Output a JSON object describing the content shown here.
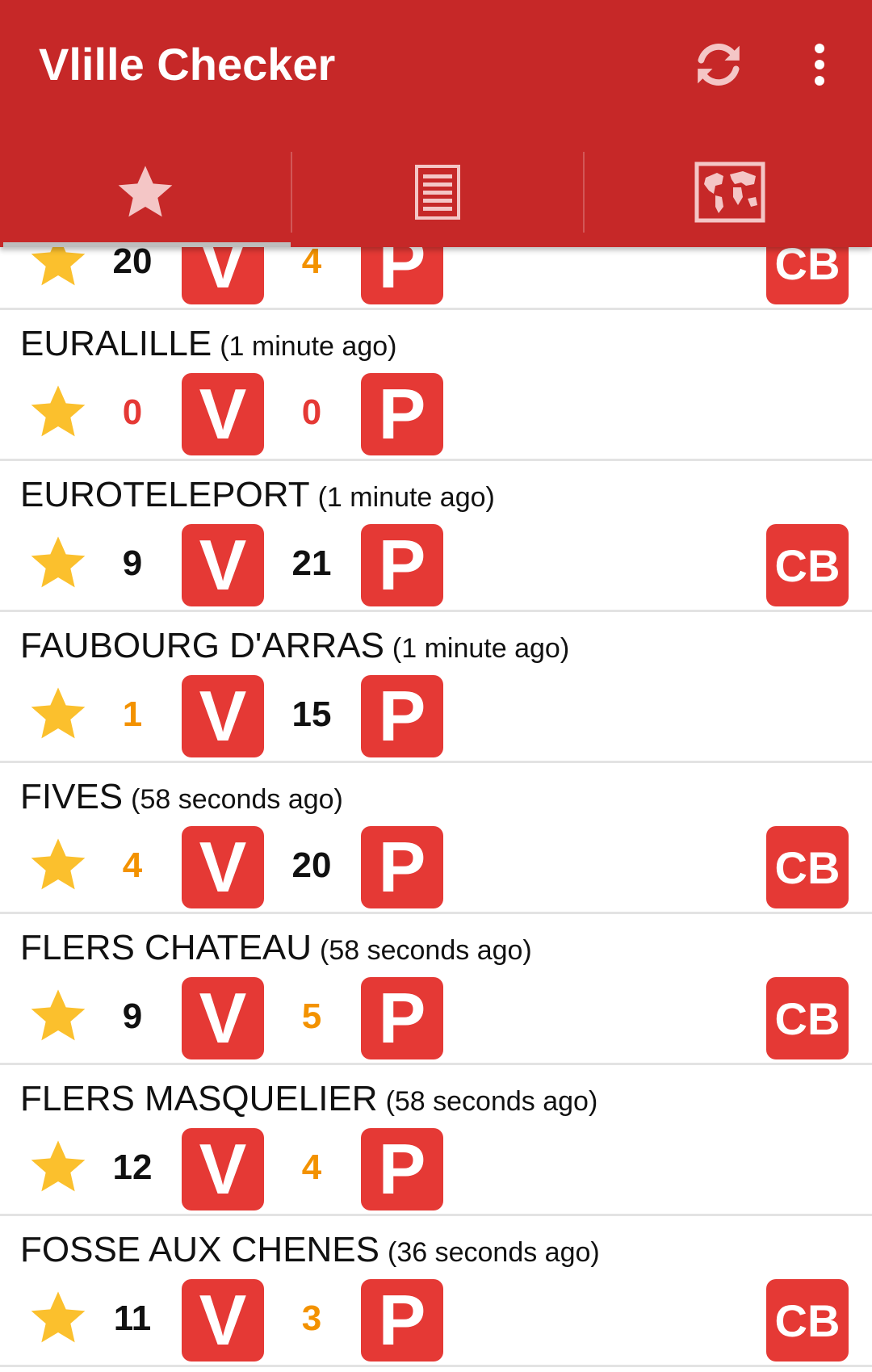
{
  "app": {
    "title": "Vlille Checker"
  },
  "actions": {
    "refresh_icon": "refresh-icon",
    "menu_icon": "more-vert-icon"
  },
  "tabs": [
    {
      "icon": "star-icon",
      "selected": true
    },
    {
      "icon": "list-icon",
      "selected": false
    },
    {
      "icon": "map-icon",
      "selected": false
    }
  ],
  "colors": {
    "primary": "#c62828",
    "badge": "#e53935",
    "star": "#fbc02d",
    "count_normal": "#111111",
    "count_low": "#f39200",
    "count_empty": "#e53935"
  },
  "badges": {
    "bikes": "V",
    "stands": "P",
    "card": "CB"
  },
  "stations": [
    {
      "name": "",
      "updated": "",
      "bikes": "20",
      "bikes_status": "normal",
      "stands": "4",
      "stands_status": "low",
      "card": true
    },
    {
      "name": "EURALILLE",
      "updated": "(1 minute ago)",
      "bikes": "0",
      "bikes_status": "empty",
      "stands": "0",
      "stands_status": "empty",
      "card": false
    },
    {
      "name": "EUROTELEPORT",
      "updated": "(1 minute ago)",
      "bikes": "9",
      "bikes_status": "normal",
      "stands": "21",
      "stands_status": "normal",
      "card": true
    },
    {
      "name": "FAUBOURG D'ARRAS",
      "updated": "(1 minute ago)",
      "bikes": "1",
      "bikes_status": "low",
      "stands": "15",
      "stands_status": "normal",
      "card": false
    },
    {
      "name": "FIVES",
      "updated": "(58 seconds ago)",
      "bikes": "4",
      "bikes_status": "low",
      "stands": "20",
      "stands_status": "normal",
      "card": true
    },
    {
      "name": "FLERS CHATEAU",
      "updated": "(58 seconds ago)",
      "bikes": "9",
      "bikes_status": "normal",
      "stands": "5",
      "stands_status": "low",
      "card": true
    },
    {
      "name": "FLERS MASQUELIER",
      "updated": "(58 seconds ago)",
      "bikes": "12",
      "bikes_status": "normal",
      "stands": "4",
      "stands_status": "low",
      "card": false
    },
    {
      "name": "FOSSE AUX CHENES",
      "updated": "(36 seconds ago)",
      "bikes": "11",
      "bikes_status": "normal",
      "stands": "3",
      "stands_status": "low",
      "card": true
    }
  ]
}
